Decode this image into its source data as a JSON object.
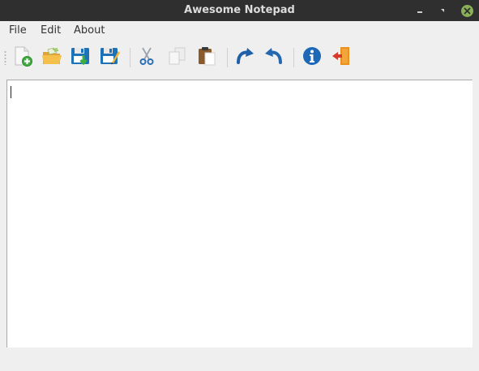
{
  "window": {
    "title": "Awesome Notepad"
  },
  "menu": {
    "items": [
      {
        "label": "File"
      },
      {
        "label": "Edit"
      },
      {
        "label": "About"
      }
    ]
  },
  "toolbar": {
    "buttons": [
      {
        "icon": "new-file-icon"
      },
      {
        "icon": "open-folder-icon"
      },
      {
        "icon": "save-icon"
      },
      {
        "icon": "save-as-icon"
      },
      {
        "icon": "cut-icon"
      },
      {
        "icon": "copy-icon"
      },
      {
        "icon": "paste-icon"
      },
      {
        "icon": "redo-icon"
      },
      {
        "icon": "undo-icon"
      },
      {
        "icon": "info-icon"
      },
      {
        "icon": "exit-icon"
      }
    ]
  },
  "editor": {
    "content": ""
  },
  "colors": {
    "titlebar": "#2f2f2f",
    "window_bg": "#efefef",
    "close_button": "#8bb158",
    "editor_bg": "#ffffff"
  }
}
